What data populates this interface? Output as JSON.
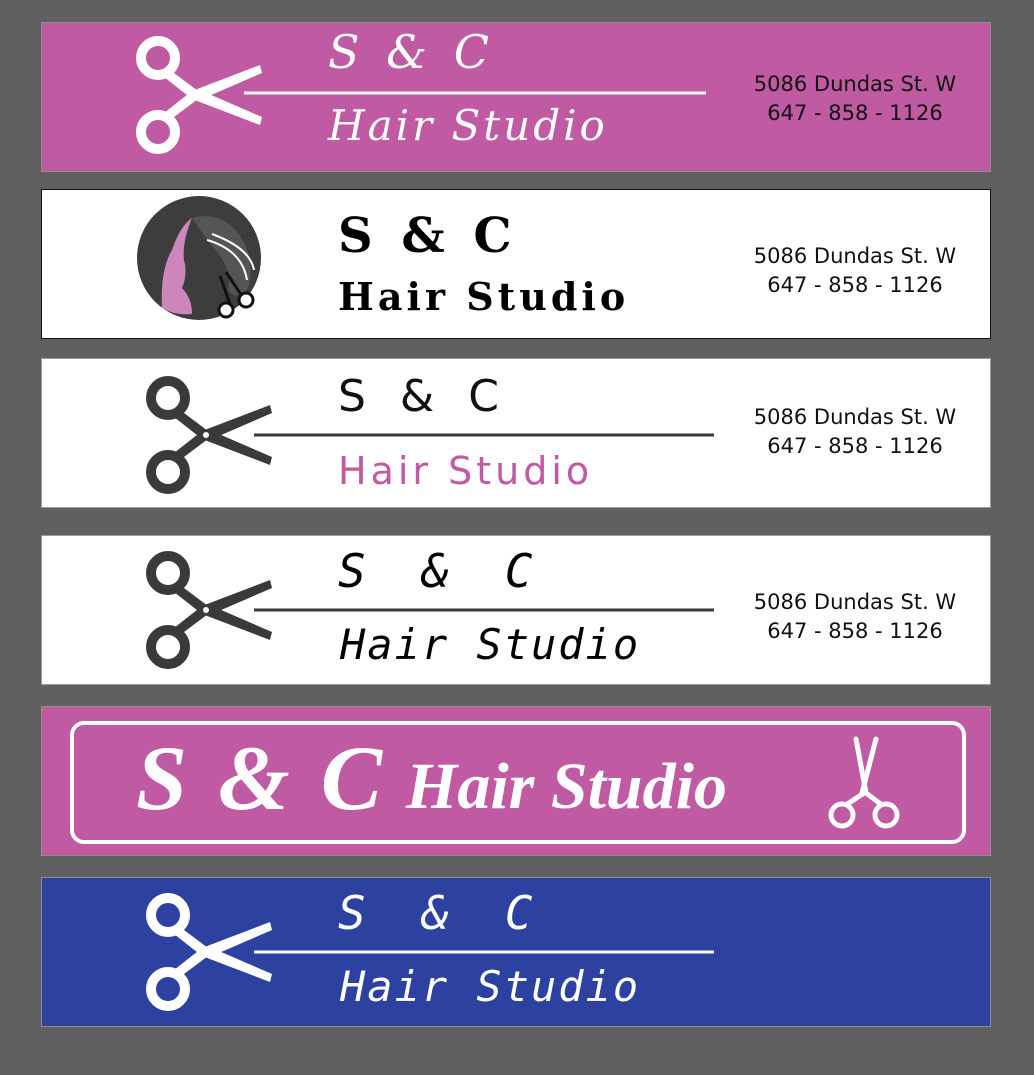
{
  "signs": [
    {
      "line1": "S & C",
      "line2": "Hair Studio",
      "address": "5086 Dundas St. W",
      "phone": "647 - 858 - 1126",
      "icon": "scissors-icon",
      "background": "#c05aa2"
    },
    {
      "line1": "S & C",
      "line2": "Hair Studio",
      "address": "5086 Dundas St. W",
      "phone": "647 - 858 - 1126",
      "icon": "woman-silhouette-scissors-icon",
      "background": "#ffffff"
    },
    {
      "line1": "S & C",
      "line2": "Hair Studio",
      "address": "5086 Dundas St. W",
      "phone": "647 - 858 - 1126",
      "icon": "scissors-icon",
      "background": "#ffffff",
      "accent": "#c05aa2"
    },
    {
      "line1": "S & C",
      "line2": "Hair Studio",
      "address": "5086 Dundas St. W",
      "phone": "647 - 858 - 1126",
      "icon": "scissors-icon",
      "background": "#ffffff"
    },
    {
      "line1": "S & C",
      "line2": "Hair Studio",
      "icon": "open-scissors-icon",
      "background": "#c05aa2"
    },
    {
      "line1": "S & C",
      "line2": "Hair Studio",
      "icon": "scissors-icon",
      "background": "#2c41a0"
    }
  ]
}
